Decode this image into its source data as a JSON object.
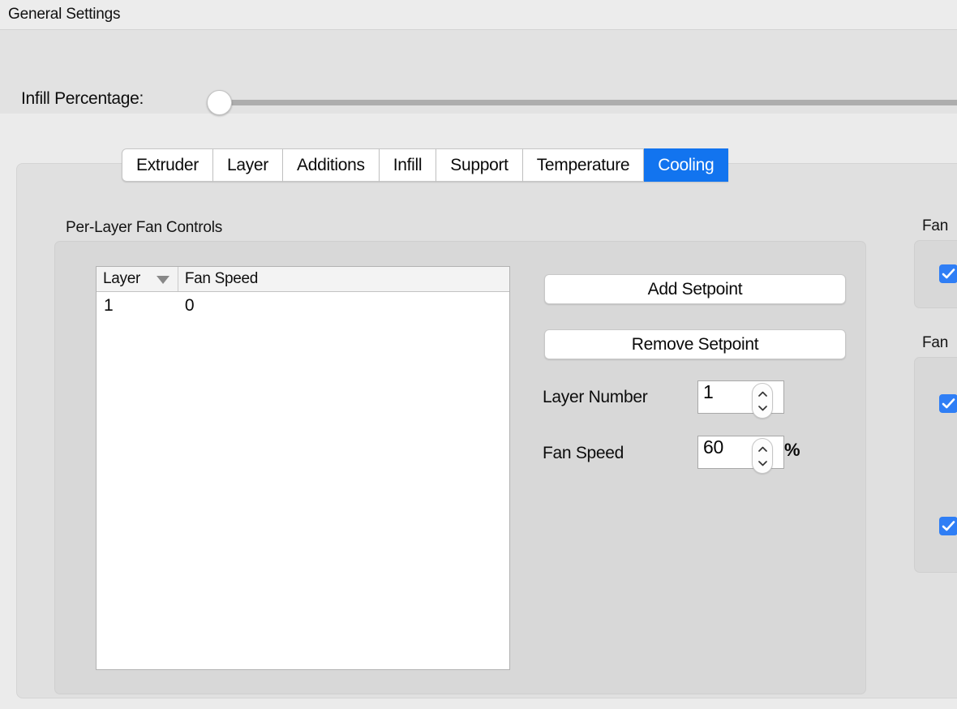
{
  "window": {
    "title": "General Settings"
  },
  "slider_row": {
    "label": "Infill Percentage:",
    "value": 0,
    "min": 0,
    "max": 100
  },
  "tabs": [
    {
      "label": "Extruder",
      "selected": false
    },
    {
      "label": "Layer",
      "selected": false
    },
    {
      "label": "Additions",
      "selected": false
    },
    {
      "label": "Infill",
      "selected": false
    },
    {
      "label": "Support",
      "selected": false
    },
    {
      "label": "Temperature",
      "selected": false
    },
    {
      "label": "Cooling",
      "selected": true
    }
  ],
  "cooling_panel": {
    "group_title": "Per-Layer Fan Controls",
    "table": {
      "columns": [
        {
          "key": "layer",
          "label": "Layer",
          "sort": "descending"
        },
        {
          "key": "speed",
          "label": "Fan Speed",
          "sort": "none"
        }
      ],
      "rows": [
        {
          "layer": "1",
          "speed": "0"
        }
      ]
    },
    "buttons": {
      "add": "Add Setpoint",
      "remove": "Remove Setpoint"
    },
    "fields": {
      "layer_number": {
        "label": "Layer Number",
        "value": "1"
      },
      "fan_speed": {
        "label": "Fan Speed",
        "value": "60",
        "unit": "%"
      }
    }
  },
  "right_panel": {
    "groups": [
      {
        "title": "Fan",
        "checkboxes": [
          {
            "checked": true
          }
        ]
      },
      {
        "title": "Fan",
        "checkboxes": [
          {
            "checked": true
          },
          {
            "checked": true
          }
        ]
      }
    ]
  },
  "colors": {
    "accent": "#1274ef",
    "checkbox": "#2f7ef5",
    "window_bg": "#ebebeb",
    "panel_bg": "#e0e0e0",
    "group_bg": "#d8d8d8"
  }
}
